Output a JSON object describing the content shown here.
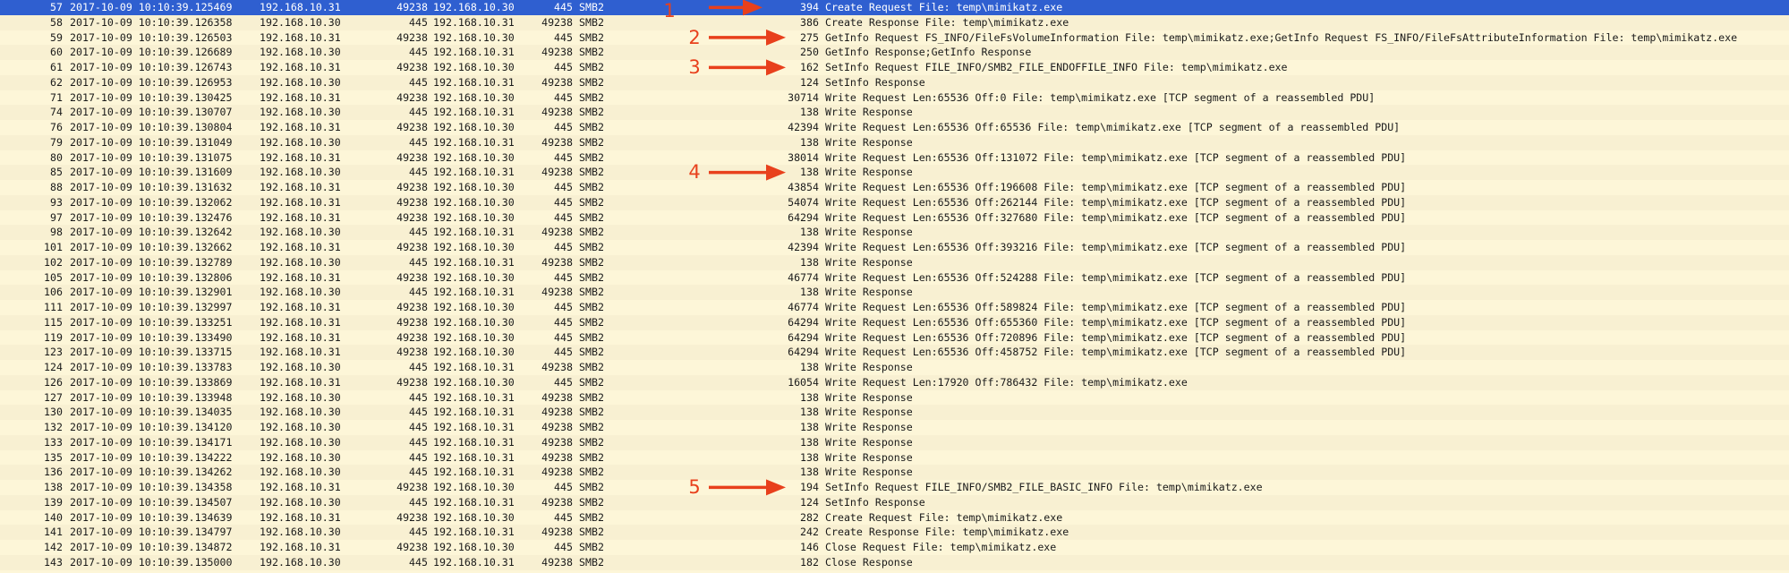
{
  "colors": {
    "selected_row": "#2f5fd0",
    "row_bg": "#fdf6d8",
    "row_bg_alt": "#f8f0d2",
    "annotation": "#e8401c"
  },
  "packets": [
    {
      "no": "57",
      "time": "2017-10-09 10:10:39.125469",
      "src": "192.168.10.31",
      "sport": "49238",
      "dst": "192.168.10.30",
      "dport": "445",
      "proto": "SMB2",
      "len": "394",
      "info": "Create Request File: temp\\mimikatz.exe",
      "selected": true
    },
    {
      "no": "58",
      "time": "2017-10-09 10:10:39.126358",
      "src": "192.168.10.30",
      "sport": "445",
      "dst": "192.168.10.31",
      "dport": "49238",
      "proto": "SMB2",
      "len": "386",
      "info": "Create Response File: temp\\mimikatz.exe"
    },
    {
      "no": "59",
      "time": "2017-10-09 10:10:39.126503",
      "src": "192.168.10.31",
      "sport": "49238",
      "dst": "192.168.10.30",
      "dport": "445",
      "proto": "SMB2",
      "len": "275",
      "info": "GetInfo Request FS_INFO/FileFsVolumeInformation File: temp\\mimikatz.exe;GetInfo Request FS_INFO/FileFsAttributeInformation File: temp\\mimikatz.exe"
    },
    {
      "no": "60",
      "time": "2017-10-09 10:10:39.126689",
      "src": "192.168.10.30",
      "sport": "445",
      "dst": "192.168.10.31",
      "dport": "49238",
      "proto": "SMB2",
      "len": "250",
      "info": "GetInfo Response;GetInfo Response"
    },
    {
      "no": "61",
      "time": "2017-10-09 10:10:39.126743",
      "src": "192.168.10.31",
      "sport": "49238",
      "dst": "192.168.10.30",
      "dport": "445",
      "proto": "SMB2",
      "len": "162",
      "info": "SetInfo Request FILE_INFO/SMB2_FILE_ENDOFFILE_INFO File: temp\\mimikatz.exe"
    },
    {
      "no": "62",
      "time": "2017-10-09 10:10:39.126953",
      "src": "192.168.10.30",
      "sport": "445",
      "dst": "192.168.10.31",
      "dport": "49238",
      "proto": "SMB2",
      "len": "124",
      "info": "SetInfo Response"
    },
    {
      "no": "71",
      "time": "2017-10-09 10:10:39.130425",
      "src": "192.168.10.31",
      "sport": "49238",
      "dst": "192.168.10.30",
      "dport": "445",
      "proto": "SMB2",
      "len": "30714",
      "info": "Write Request Len:65536 Off:0 File: temp\\mimikatz.exe [TCP segment of a reassembled PDU]"
    },
    {
      "no": "74",
      "time": "2017-10-09 10:10:39.130707",
      "src": "192.168.10.30",
      "sport": "445",
      "dst": "192.168.10.31",
      "dport": "49238",
      "proto": "SMB2",
      "len": "138",
      "info": "Write Response"
    },
    {
      "no": "76",
      "time": "2017-10-09 10:10:39.130804",
      "src": "192.168.10.31",
      "sport": "49238",
      "dst": "192.168.10.30",
      "dport": "445",
      "proto": "SMB2",
      "len": "42394",
      "info": "Write Request Len:65536 Off:65536 File: temp\\mimikatz.exe [TCP segment of a reassembled PDU]"
    },
    {
      "no": "79",
      "time": "2017-10-09 10:10:39.131049",
      "src": "192.168.10.30",
      "sport": "445",
      "dst": "192.168.10.31",
      "dport": "49238",
      "proto": "SMB2",
      "len": "138",
      "info": "Write Response"
    },
    {
      "no": "80",
      "time": "2017-10-09 10:10:39.131075",
      "src": "192.168.10.31",
      "sport": "49238",
      "dst": "192.168.10.30",
      "dport": "445",
      "proto": "SMB2",
      "len": "38014",
      "info": "Write Request Len:65536 Off:131072 File: temp\\mimikatz.exe [TCP segment of a reassembled PDU]"
    },
    {
      "no": "85",
      "time": "2017-10-09 10:10:39.131609",
      "src": "192.168.10.30",
      "sport": "445",
      "dst": "192.168.10.31",
      "dport": "49238",
      "proto": "SMB2",
      "len": "138",
      "info": "Write Response"
    },
    {
      "no": "88",
      "time": "2017-10-09 10:10:39.131632",
      "src": "192.168.10.31",
      "sport": "49238",
      "dst": "192.168.10.30",
      "dport": "445",
      "proto": "SMB2",
      "len": "43854",
      "info": "Write Request Len:65536 Off:196608 File: temp\\mimikatz.exe [TCP segment of a reassembled PDU]"
    },
    {
      "no": "93",
      "time": "2017-10-09 10:10:39.132062",
      "src": "192.168.10.31",
      "sport": "49238",
      "dst": "192.168.10.30",
      "dport": "445",
      "proto": "SMB2",
      "len": "54074",
      "info": "Write Request Len:65536 Off:262144 File: temp\\mimikatz.exe [TCP segment of a reassembled PDU]"
    },
    {
      "no": "97",
      "time": "2017-10-09 10:10:39.132476",
      "src": "192.168.10.31",
      "sport": "49238",
      "dst": "192.168.10.30",
      "dport": "445",
      "proto": "SMB2",
      "len": "64294",
      "info": "Write Request Len:65536 Off:327680 File: temp\\mimikatz.exe [TCP segment of a reassembled PDU]"
    },
    {
      "no": "98",
      "time": "2017-10-09 10:10:39.132642",
      "src": "192.168.10.30",
      "sport": "445",
      "dst": "192.168.10.31",
      "dport": "49238",
      "proto": "SMB2",
      "len": "138",
      "info": "Write Response"
    },
    {
      "no": "101",
      "time": "2017-10-09 10:10:39.132662",
      "src": "192.168.10.31",
      "sport": "49238",
      "dst": "192.168.10.30",
      "dport": "445",
      "proto": "SMB2",
      "len": "42394",
      "info": "Write Request Len:65536 Off:393216 File: temp\\mimikatz.exe [TCP segment of a reassembled PDU]"
    },
    {
      "no": "102",
      "time": "2017-10-09 10:10:39.132789",
      "src": "192.168.10.30",
      "sport": "445",
      "dst": "192.168.10.31",
      "dport": "49238",
      "proto": "SMB2",
      "len": "138",
      "info": "Write Response"
    },
    {
      "no": "105",
      "time": "2017-10-09 10:10:39.132806",
      "src": "192.168.10.31",
      "sport": "49238",
      "dst": "192.168.10.30",
      "dport": "445",
      "proto": "SMB2",
      "len": "46774",
      "info": "Write Request Len:65536 Off:524288 File: temp\\mimikatz.exe [TCP segment of a reassembled PDU]"
    },
    {
      "no": "106",
      "time": "2017-10-09 10:10:39.132901",
      "src": "192.168.10.30",
      "sport": "445",
      "dst": "192.168.10.31",
      "dport": "49238",
      "proto": "SMB2",
      "len": "138",
      "info": "Write Response"
    },
    {
      "no": "111",
      "time": "2017-10-09 10:10:39.132997",
      "src": "192.168.10.31",
      "sport": "49238",
      "dst": "192.168.10.30",
      "dport": "445",
      "proto": "SMB2",
      "len": "46774",
      "info": "Write Request Len:65536 Off:589824 File: temp\\mimikatz.exe [TCP segment of a reassembled PDU]"
    },
    {
      "no": "115",
      "time": "2017-10-09 10:10:39.133251",
      "src": "192.168.10.31",
      "sport": "49238",
      "dst": "192.168.10.30",
      "dport": "445",
      "proto": "SMB2",
      "len": "64294",
      "info": "Write Request Len:65536 Off:655360 File: temp\\mimikatz.exe [TCP segment of a reassembled PDU]"
    },
    {
      "no": "119",
      "time": "2017-10-09 10:10:39.133490",
      "src": "192.168.10.31",
      "sport": "49238",
      "dst": "192.168.10.30",
      "dport": "445",
      "proto": "SMB2",
      "len": "64294",
      "info": "Write Request Len:65536 Off:720896 File: temp\\mimikatz.exe [TCP segment of a reassembled PDU]"
    },
    {
      "no": "123",
      "time": "2017-10-09 10:10:39.133715",
      "src": "192.168.10.31",
      "sport": "49238",
      "dst": "192.168.10.30",
      "dport": "445",
      "proto": "SMB2",
      "len": "64294",
      "info": "Write Request Len:65536 Off:458752 File: temp\\mimikatz.exe [TCP segment of a reassembled PDU]"
    },
    {
      "no": "124",
      "time": "2017-10-09 10:10:39.133783",
      "src": "192.168.10.30",
      "sport": "445",
      "dst": "192.168.10.31",
      "dport": "49238",
      "proto": "SMB2",
      "len": "138",
      "info": "Write Response"
    },
    {
      "no": "126",
      "time": "2017-10-09 10:10:39.133869",
      "src": "192.168.10.31",
      "sport": "49238",
      "dst": "192.168.10.30",
      "dport": "445",
      "proto": "SMB2",
      "len": "16054",
      "info": "Write Request Len:17920 Off:786432 File: temp\\mimikatz.exe"
    },
    {
      "no": "127",
      "time": "2017-10-09 10:10:39.133948",
      "src": "192.168.10.30",
      "sport": "445",
      "dst": "192.168.10.31",
      "dport": "49238",
      "proto": "SMB2",
      "len": "138",
      "info": "Write Response"
    },
    {
      "no": "130",
      "time": "2017-10-09 10:10:39.134035",
      "src": "192.168.10.30",
      "sport": "445",
      "dst": "192.168.10.31",
      "dport": "49238",
      "proto": "SMB2",
      "len": "138",
      "info": "Write Response"
    },
    {
      "no": "132",
      "time": "2017-10-09 10:10:39.134120",
      "src": "192.168.10.30",
      "sport": "445",
      "dst": "192.168.10.31",
      "dport": "49238",
      "proto": "SMB2",
      "len": "138",
      "info": "Write Response"
    },
    {
      "no": "133",
      "time": "2017-10-09 10:10:39.134171",
      "src": "192.168.10.30",
      "sport": "445",
      "dst": "192.168.10.31",
      "dport": "49238",
      "proto": "SMB2",
      "len": "138",
      "info": "Write Response"
    },
    {
      "no": "135",
      "time": "2017-10-09 10:10:39.134222",
      "src": "192.168.10.30",
      "sport": "445",
      "dst": "192.168.10.31",
      "dport": "49238",
      "proto": "SMB2",
      "len": "138",
      "info": "Write Response"
    },
    {
      "no": "136",
      "time": "2017-10-09 10:10:39.134262",
      "src": "192.168.10.30",
      "sport": "445",
      "dst": "192.168.10.31",
      "dport": "49238",
      "proto": "SMB2",
      "len": "138",
      "info": "Write Response"
    },
    {
      "no": "138",
      "time": "2017-10-09 10:10:39.134358",
      "src": "192.168.10.31",
      "sport": "49238",
      "dst": "192.168.10.30",
      "dport": "445",
      "proto": "SMB2",
      "len": "194",
      "info": "SetInfo Request FILE_INFO/SMB2_FILE_BASIC_INFO File: temp\\mimikatz.exe"
    },
    {
      "no": "139",
      "time": "2017-10-09 10:10:39.134507",
      "src": "192.168.10.30",
      "sport": "445",
      "dst": "192.168.10.31",
      "dport": "49238",
      "proto": "SMB2",
      "len": "124",
      "info": "SetInfo Response"
    },
    {
      "no": "140",
      "time": "2017-10-09 10:10:39.134639",
      "src": "192.168.10.31",
      "sport": "49238",
      "dst": "192.168.10.30",
      "dport": "445",
      "proto": "SMB2",
      "len": "282",
      "info": "Create Request File: temp\\mimikatz.exe"
    },
    {
      "no": "141",
      "time": "2017-10-09 10:10:39.134797",
      "src": "192.168.10.30",
      "sport": "445",
      "dst": "192.168.10.31",
      "dport": "49238",
      "proto": "SMB2",
      "len": "242",
      "info": "Create Response File: temp\\mimikatz.exe"
    },
    {
      "no": "142",
      "time": "2017-10-09 10:10:39.134872",
      "src": "192.168.10.31",
      "sport": "49238",
      "dst": "192.168.10.30",
      "dport": "445",
      "proto": "SMB2",
      "len": "146",
      "info": "Close Request File: temp\\mimikatz.exe"
    },
    {
      "no": "143",
      "time": "2017-10-09 10:10:39.135000",
      "src": "192.168.10.30",
      "sport": "445",
      "dst": "192.168.10.31",
      "dport": "49238",
      "proto": "SMB2",
      "len": "182",
      "info": "Close Response"
    }
  ],
  "annotations": [
    {
      "label": "1",
      "row": 0
    },
    {
      "label": "2",
      "row": 2
    },
    {
      "label": "3",
      "row": 4
    },
    {
      "label": "4",
      "row": 11
    },
    {
      "label": "5",
      "row": 32
    }
  ]
}
